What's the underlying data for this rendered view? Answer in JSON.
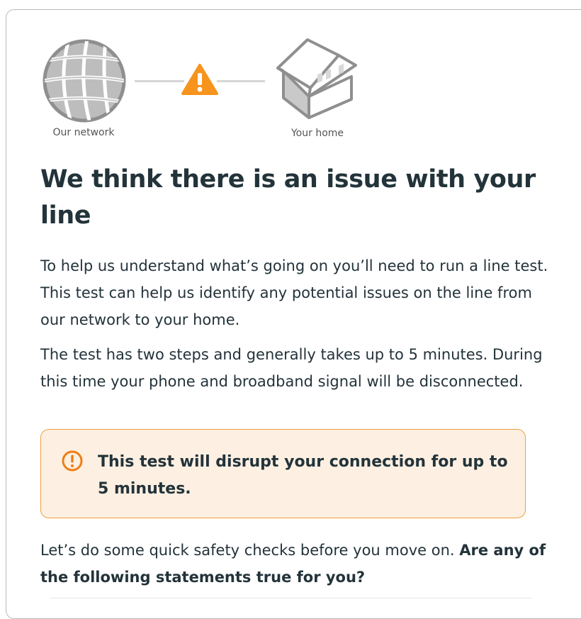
{
  "diagram": {
    "network_label": "Our network",
    "home_label": "Your home",
    "colors": {
      "icon_grey": "#8f8f8f",
      "warning": "#f7941d",
      "connector": "#d6d6d6"
    },
    "icons": [
      "globe-icon",
      "warning-icon",
      "house-icon"
    ]
  },
  "heading": "We think there is an issue with your line",
  "paragraph_1": "To help us understand what’s going on you’ll need to run a line test. This test can help us identify any potential issues on the line from our network to your home.",
  "paragraph_2": "The test has two steps and generally takes up to 5 minutes. During this time your phone and broadband signal will be disconnected.",
  "alert": {
    "text": "This test will disrupt your connection for up to 5 minutes.",
    "icon": "exclamation-circle-icon",
    "colors": {
      "background": "#fdf0e2",
      "border": "#f0a040",
      "icon": "#f07d16"
    }
  },
  "safety": {
    "intro": "Let’s do some quick safety checks before you move on. ",
    "question": "Are any of the following statements true for you?"
  }
}
